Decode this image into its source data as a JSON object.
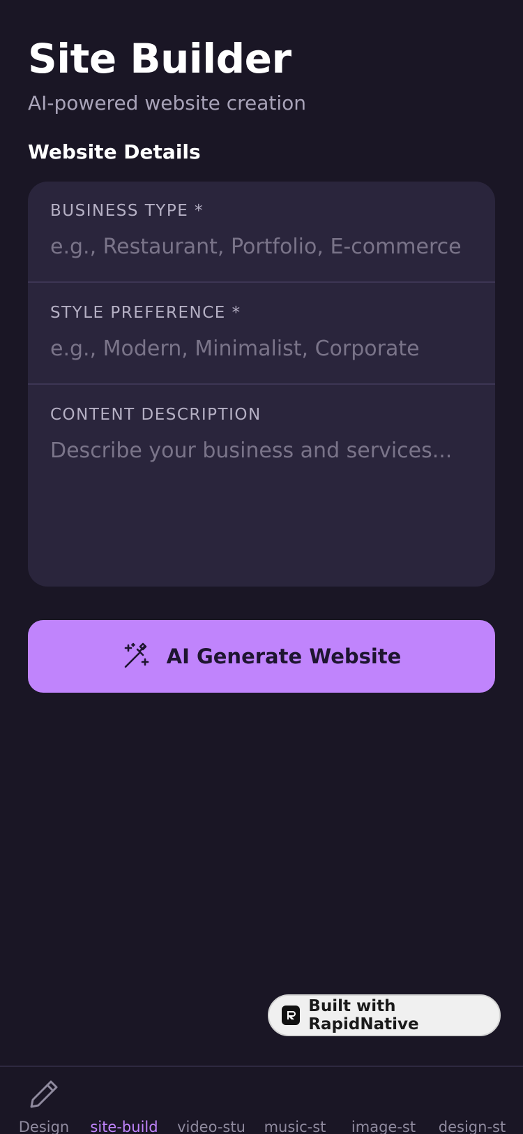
{
  "header": {
    "title": "Site Builder",
    "subtitle": "AI-powered website creation"
  },
  "form": {
    "section_title": "Website Details",
    "business_type": {
      "label": "BUSINESS TYPE *",
      "placeholder": "e.g., Restaurant, Portfolio, E-commerce",
      "value": ""
    },
    "style_preference": {
      "label": "STYLE PREFERENCE *",
      "placeholder": "e.g., Modern, Minimalist, Corporate",
      "value": ""
    },
    "content_description": {
      "label": "CONTENT DESCRIPTION",
      "placeholder": "Describe your business and services...",
      "value": ""
    }
  },
  "generate_button": {
    "label": "AI Generate Website",
    "icon": "magic-wand-icon",
    "color": "#c084fc"
  },
  "badge": {
    "label": "Built with RapidNative"
  },
  "tabs": [
    {
      "label": "Design",
      "icon": "pencil-icon",
      "active": false
    },
    {
      "label": "site-build",
      "active": true
    },
    {
      "label": "video-stu",
      "active": false
    },
    {
      "label": "music-st",
      "active": false
    },
    {
      "label": "image-st",
      "active": false
    },
    {
      "label": "design-st",
      "active": false
    }
  ],
  "colors": {
    "background": "#1a1625",
    "card": "#2a253c",
    "accent": "#c084fc"
  }
}
